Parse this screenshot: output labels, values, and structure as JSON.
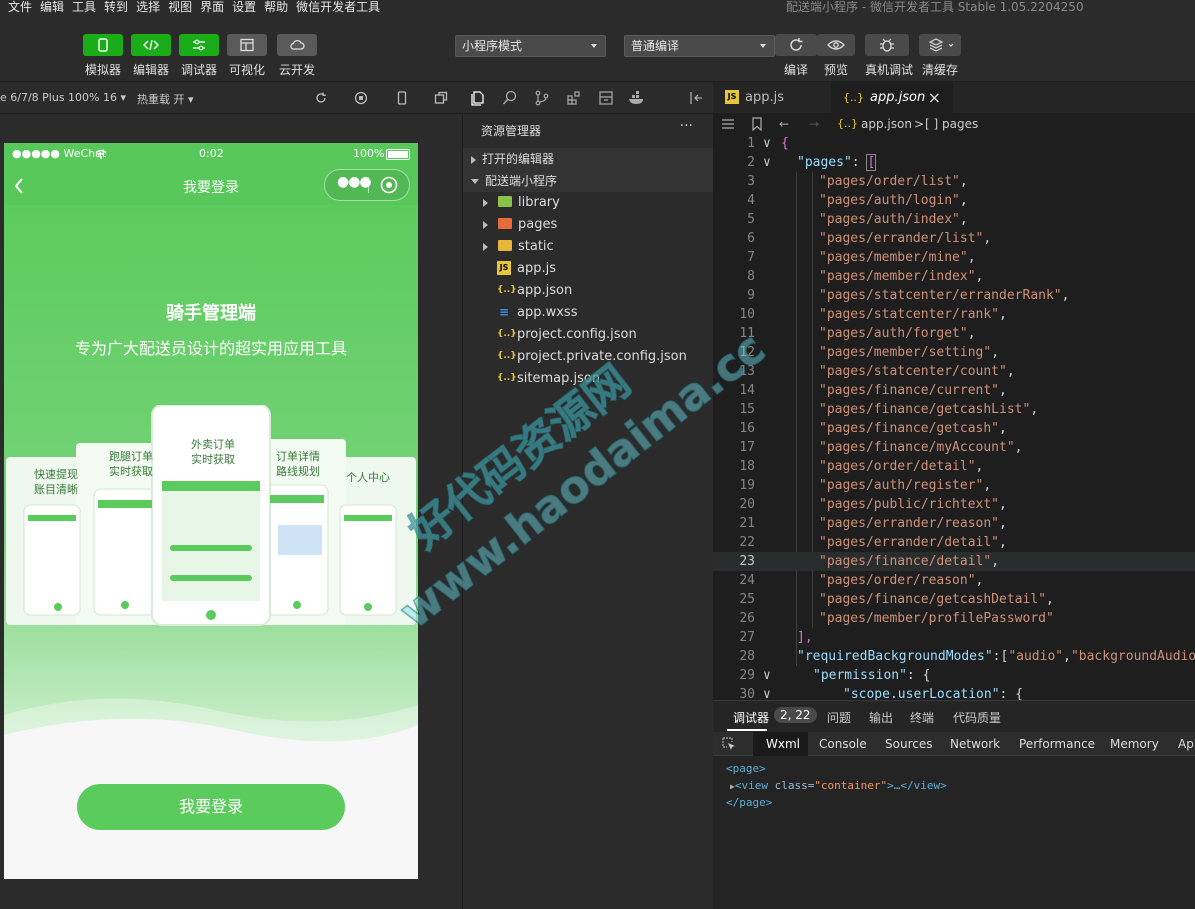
{
  "menu": {
    "items": [
      "文件",
      "编辑",
      "工具",
      "转到",
      "选择",
      "视图",
      "界面",
      "设置",
      "帮助",
      "微信开发者工具"
    ],
    "window_title": "配送端小程序 - 微信开发者工具 Stable 1.05.2204250"
  },
  "toolbar": {
    "simulator": "模拟器",
    "editor": "编辑器",
    "debugger": "调试器",
    "visualize": "可视化",
    "cloud": "云开发",
    "mode_select": "小程序模式",
    "compile_select": "普通编译",
    "compile": "编译",
    "preview": "预览",
    "real_debug": "真机调试",
    "clear_cache": "清缓存"
  },
  "simulator": {
    "device": "e 6/7/8 Plus 100% 16",
    "hot_reload": "热重载 开",
    "status_signal": "●●●●● WeChat",
    "status_time": "0:02",
    "status_battery": "100%",
    "nav_title": "我要登录",
    "hero_title": "骑手管理端",
    "hero_subtitle": "专为广大配送员设计的超实用应用工具",
    "screen_labels": [
      "快速提现",
      "账目清晰",
      "跑腿订单",
      "实时获取",
      "外卖订单",
      "实时获取",
      "订单详情",
      "路线规划",
      "个人中心"
    ],
    "login_button": "我要登录"
  },
  "explorer": {
    "header": "资源管理器",
    "more": "···",
    "open_editors": "打开的编辑器",
    "project": "配送端小程序",
    "items": [
      {
        "name": "library",
        "type": "folder",
        "color": "#8bc34a"
      },
      {
        "name": "pages",
        "type": "folder",
        "color": "#e86c3b"
      },
      {
        "name": "static",
        "type": "folder",
        "color": "#e8b53b"
      },
      {
        "name": "app.js",
        "type": "js",
        "color": "#e8c63b"
      },
      {
        "name": "app.json",
        "type": "json",
        "color": "#e8c63b"
      },
      {
        "name": "app.wxss",
        "type": "css",
        "color": "#3b8ee8"
      },
      {
        "name": "project.config.json",
        "type": "json",
        "color": "#e8c63b"
      },
      {
        "name": "project.private.config.json",
        "type": "json",
        "color": "#e8c63b"
      },
      {
        "name": "sitemap.json",
        "type": "json",
        "color": "#e8c63b"
      }
    ]
  },
  "editor": {
    "tabs": [
      {
        "label": "app.js",
        "active": false
      },
      {
        "label": "app.json",
        "active": true
      }
    ],
    "close_icon": "×",
    "breadcrumb_file": "app.json",
    "breadcrumb_sep": ">",
    "breadcrumb_node": "[ ] pages",
    "current_line": 23,
    "lines": [
      {
        "n": 1,
        "fold": "∨",
        "text": "{"
      },
      {
        "n": 2,
        "fold": "∨",
        "key": "\"pages\"",
        "rest": ": ",
        "bracket": "["
      },
      {
        "n": 3,
        "str": "\"pages/order/list\"",
        "end": ","
      },
      {
        "n": 4,
        "str": "\"pages/auth/login\"",
        "end": ","
      },
      {
        "n": 5,
        "str": "\"pages/auth/index\"",
        "end": ","
      },
      {
        "n": 6,
        "str": "\"pages/errander/list\"",
        "end": ","
      },
      {
        "n": 7,
        "str": "\"pages/member/mine\"",
        "end": ","
      },
      {
        "n": 8,
        "str": "\"pages/member/index\"",
        "end": ","
      },
      {
        "n": 9,
        "str": "\"pages/statcenter/erranderRank\"",
        "end": ","
      },
      {
        "n": 10,
        "str": "\"pages/statcenter/rank\"",
        "end": ","
      },
      {
        "n": 11,
        "str": "\"pages/auth/forget\"",
        "end": ","
      },
      {
        "n": 12,
        "str": "\"pages/member/setting\"",
        "end": ","
      },
      {
        "n": 13,
        "str": "\"pages/statcenter/count\"",
        "end": ","
      },
      {
        "n": 14,
        "str": "\"pages/finance/current\"",
        "end": ","
      },
      {
        "n": 15,
        "str": "\"pages/finance/getcashList\"",
        "end": ","
      },
      {
        "n": 16,
        "str": "\"pages/finance/getcash\"",
        "end": ","
      },
      {
        "n": 17,
        "str": "\"pages/finance/myAccount\"",
        "end": ","
      },
      {
        "n": 18,
        "str": "\"pages/order/detail\"",
        "end": ","
      },
      {
        "n": 19,
        "str": "\"pages/auth/register\"",
        "end": ","
      },
      {
        "n": 20,
        "str": "\"pages/public/richtext\"",
        "end": ","
      },
      {
        "n": 21,
        "str": "\"pages/errander/reason\"",
        "end": ","
      },
      {
        "n": 22,
        "str": "\"pages/errander/detail\"",
        "end": ","
      },
      {
        "n": 23,
        "str": "\"pages/finance/detail\"",
        "end": ","
      },
      {
        "n": 24,
        "str": "\"pages/order/reason\"",
        "end": ","
      },
      {
        "n": 25,
        "str": "\"pages/finance/getcashDetail\"",
        "end": ","
      },
      {
        "n": 26,
        "str": "\"pages/member/profilePassword\"",
        "end": ""
      },
      {
        "n": 27,
        "close": "],"
      },
      {
        "n": 28,
        "key": "\"requiredBackgroundModes\"",
        "rest": ":[",
        "s1": "\"audio\"",
        "s2": "\"backgroundAudioM"
      },
      {
        "n": 29,
        "fold": "∨",
        "key": "\"permission\"",
        "rest": ": {"
      },
      {
        "n": 30,
        "fold": "∨",
        "key": "\"scope.userLocation\"",
        "rest": ": {"
      }
    ]
  },
  "debug": {
    "tabs": [
      "调试器",
      "问题",
      "输出",
      "终端",
      "代码质量"
    ],
    "badge": "2, 22",
    "subtabs": [
      "Wxml",
      "Console",
      "Sources",
      "Network",
      "Performance",
      "Memory",
      "App"
    ],
    "wxml": {
      "open": "<page>",
      "child_tag": "<view",
      "child_attr": " class=",
      "child_val": "\"container\"",
      "child_rest": ">…</view>",
      "close": "</page>"
    }
  },
  "watermark": {
    "line1": "好代码资源网",
    "line2": "www.haodaima.cc"
  },
  "colors": {
    "accent_green": "#1aad19",
    "phone_green": "#5ccb5e",
    "editor_bg": "#1e1e1e"
  }
}
